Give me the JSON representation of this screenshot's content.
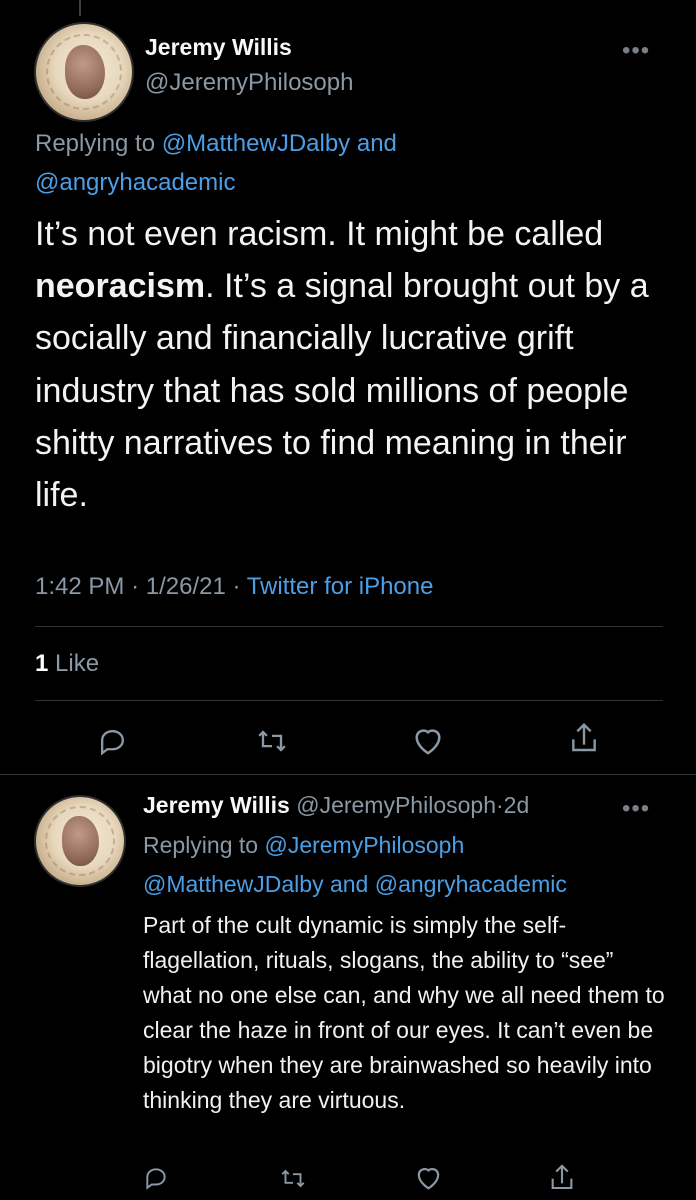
{
  "main_tweet": {
    "author_name": "Jeremy Willis",
    "author_handle": "@JeremyPhilosoph",
    "replying_prefix": "Replying to",
    "replying_handle_1": "@MatthewJDalby",
    "replying_and": "and",
    "replying_handle_2": "@angryhacademic",
    "text_part_1": "It’s not even racism. It might be called",
    "text_bold": "neoracism",
    "text_part_2": ". It’s a signal brought out by a socially and financially lucrative grift industry that has sold millions of people shitty narratives to find meaning in their life.",
    "time": "1:42 PM",
    "date": "1/26/21",
    "source": "Twitter for iPhone",
    "like_count": "1",
    "like_label": "Like"
  },
  "reply_tweet": {
    "author_name": "Jeremy Willis",
    "author_handle": "@JeremyPhilosoph",
    "age": "2d",
    "replying_prefix": "Replying to",
    "replying_handle_1": "@JeremyPhilosoph",
    "replying_handle_2": "@MatthewJDalby",
    "replying_and": "and",
    "replying_handle_3": "@angryhacademic",
    "text": "Part of the cult dynamic is simply the self-flagellation, rituals, slogans, the ability to “see” what no one else can, and why we all need them to clear the haze in front of our eyes. It can’t even be bigotry when they are brainwashed so heavily into thinking they are virtuous."
  },
  "icons": {
    "more": "more-horizontal-icon",
    "reply": "reply-icon",
    "retweet": "retweet-icon",
    "like": "heart-icon",
    "share": "share-icon"
  },
  "colors": {
    "background": "#000000",
    "text": "#e7e9ea",
    "muted": "#8b98a5",
    "link": "#4c9fe6"
  }
}
